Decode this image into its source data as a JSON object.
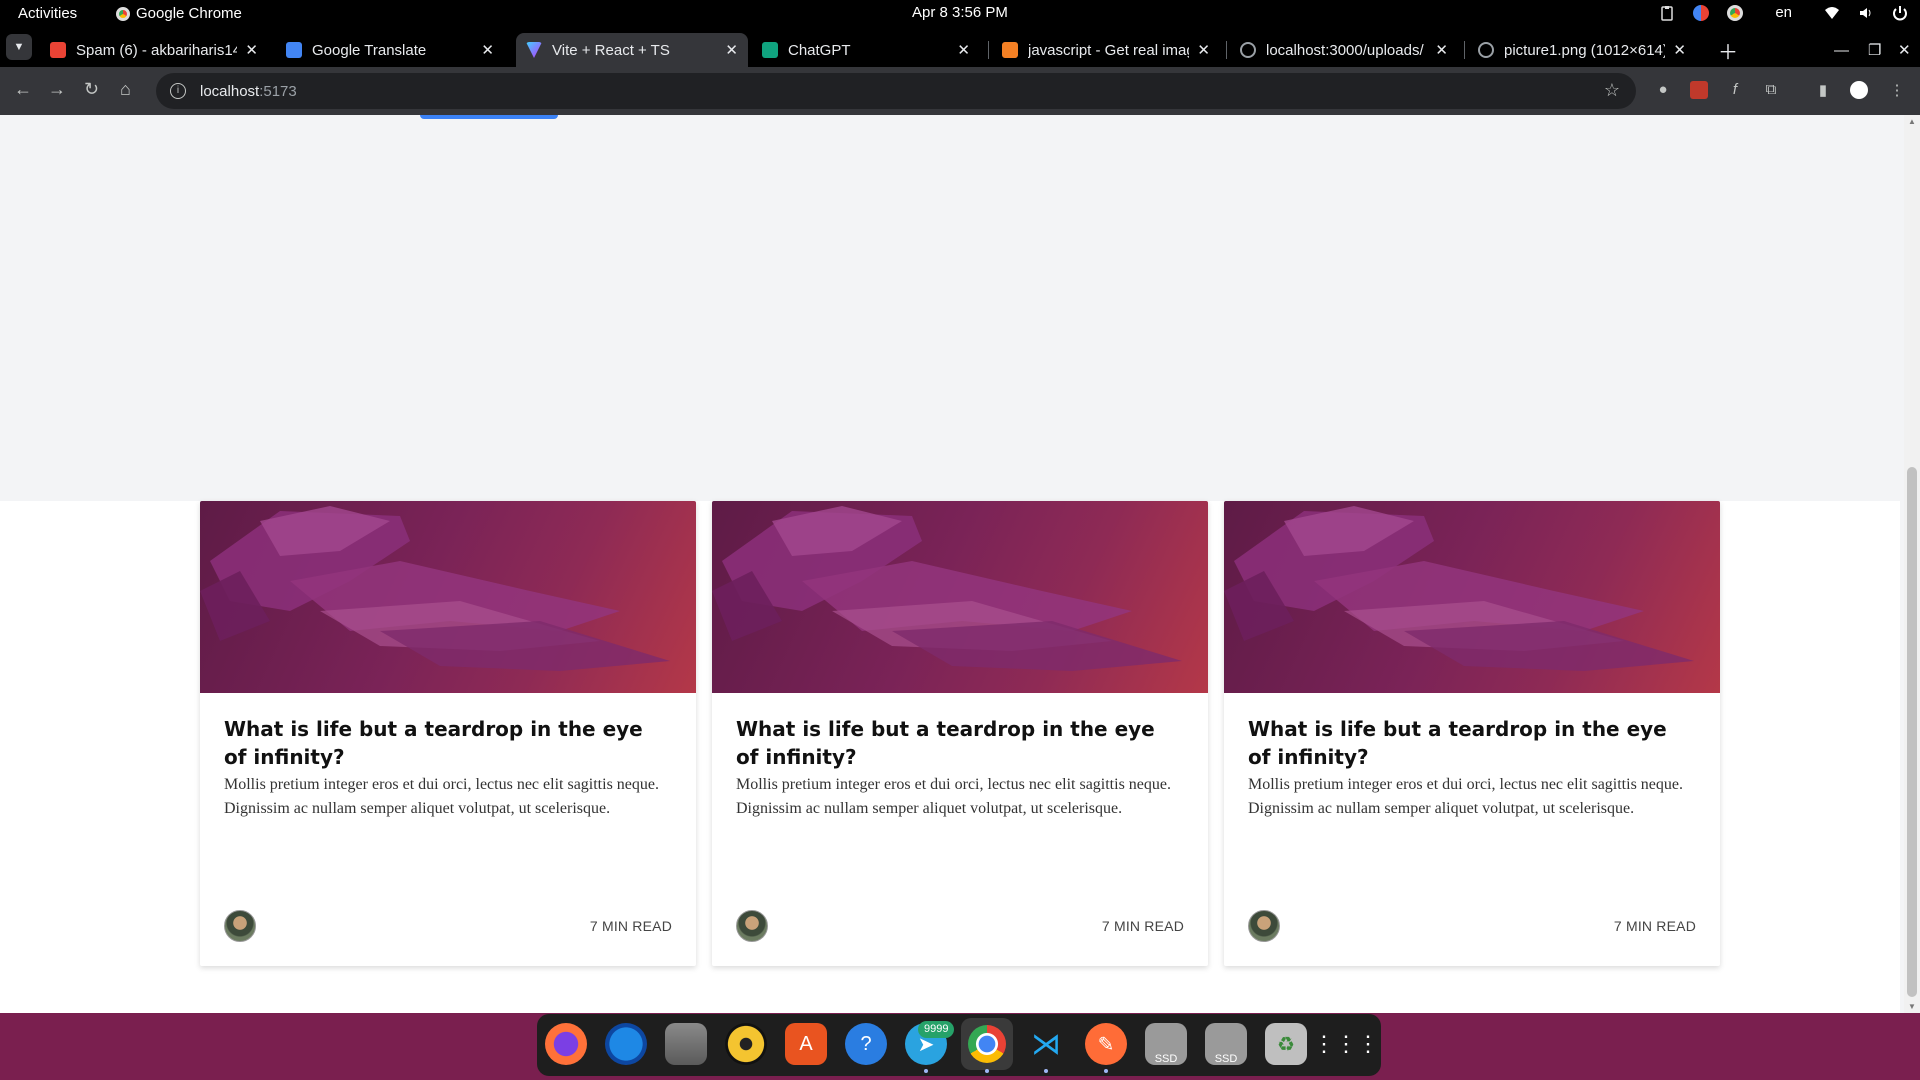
{
  "topbar": {
    "activities": "Activities",
    "app_name": "Google Chrome",
    "clock": "Apr 8  3:56 PM",
    "lang": "en"
  },
  "tabs": [
    {
      "label": "Spam (6) - akbariharis14",
      "favicon": "gmail-icon",
      "color": "#ea4335"
    },
    {
      "label": "Google Translate",
      "favicon": "translate-icon",
      "color": "#4285f4"
    },
    {
      "label": "Vite + React + TS",
      "favicon": "vite-icon",
      "color": "#bd34fe",
      "active": true
    },
    {
      "label": "ChatGPT",
      "favicon": "chatgpt-icon",
      "color": "#10a37f"
    },
    {
      "label": "javascript - Get real imag",
      "favicon": "stackoverflow-icon",
      "color": "#f48024"
    },
    {
      "label": "localhost:3000/uploads/",
      "favicon": "globe-icon",
      "color": "#9aa0a6"
    },
    {
      "label": "picture1.png (1012×614)",
      "favicon": "globe-icon",
      "color": "#9aa0a6"
    }
  ],
  "toolbar": {
    "url_host": "localhost",
    "url_port": ":5173"
  },
  "cards": [
    {
      "title": "What is life but a teardrop in the eye of infinity?",
      "excerpt": "Mollis pretium integer eros et dui orci, lectus nec elit sagittis neque. Dignissim ac nullam semper aliquet volutpat, ut scelerisque.",
      "read_time": "7 MIN READ"
    },
    {
      "title": "What is life but a teardrop in the eye of infinity?",
      "excerpt": "Mollis pretium integer eros et dui orci, lectus nec elit sagittis neque. Dignissim ac nullam semper aliquet volutpat, ut scelerisque.",
      "read_time": "7 MIN READ"
    },
    {
      "title": "What is life but a teardrop in the eye of infinity?",
      "excerpt": "Mollis pretium integer eros et dui orci, lectus nec elit sagittis neque. Dignissim ac nullam semper aliquet volutpat, ut scelerisque.",
      "read_time": "7 MIN READ"
    }
  ],
  "dock": {
    "apps": [
      "firefox-icon",
      "thunderbird-icon",
      "files-icon",
      "rhythmbox-icon",
      "app-center-icon",
      "help-icon",
      "telegram-icon",
      "chrome-icon",
      "vscode-icon",
      "postman-icon",
      "drive-ssd-icon",
      "drive-ssd-icon",
      "trash-icon",
      "show-apps-icon"
    ],
    "telegram_badge": "9999",
    "ssd_label": "SSD"
  }
}
